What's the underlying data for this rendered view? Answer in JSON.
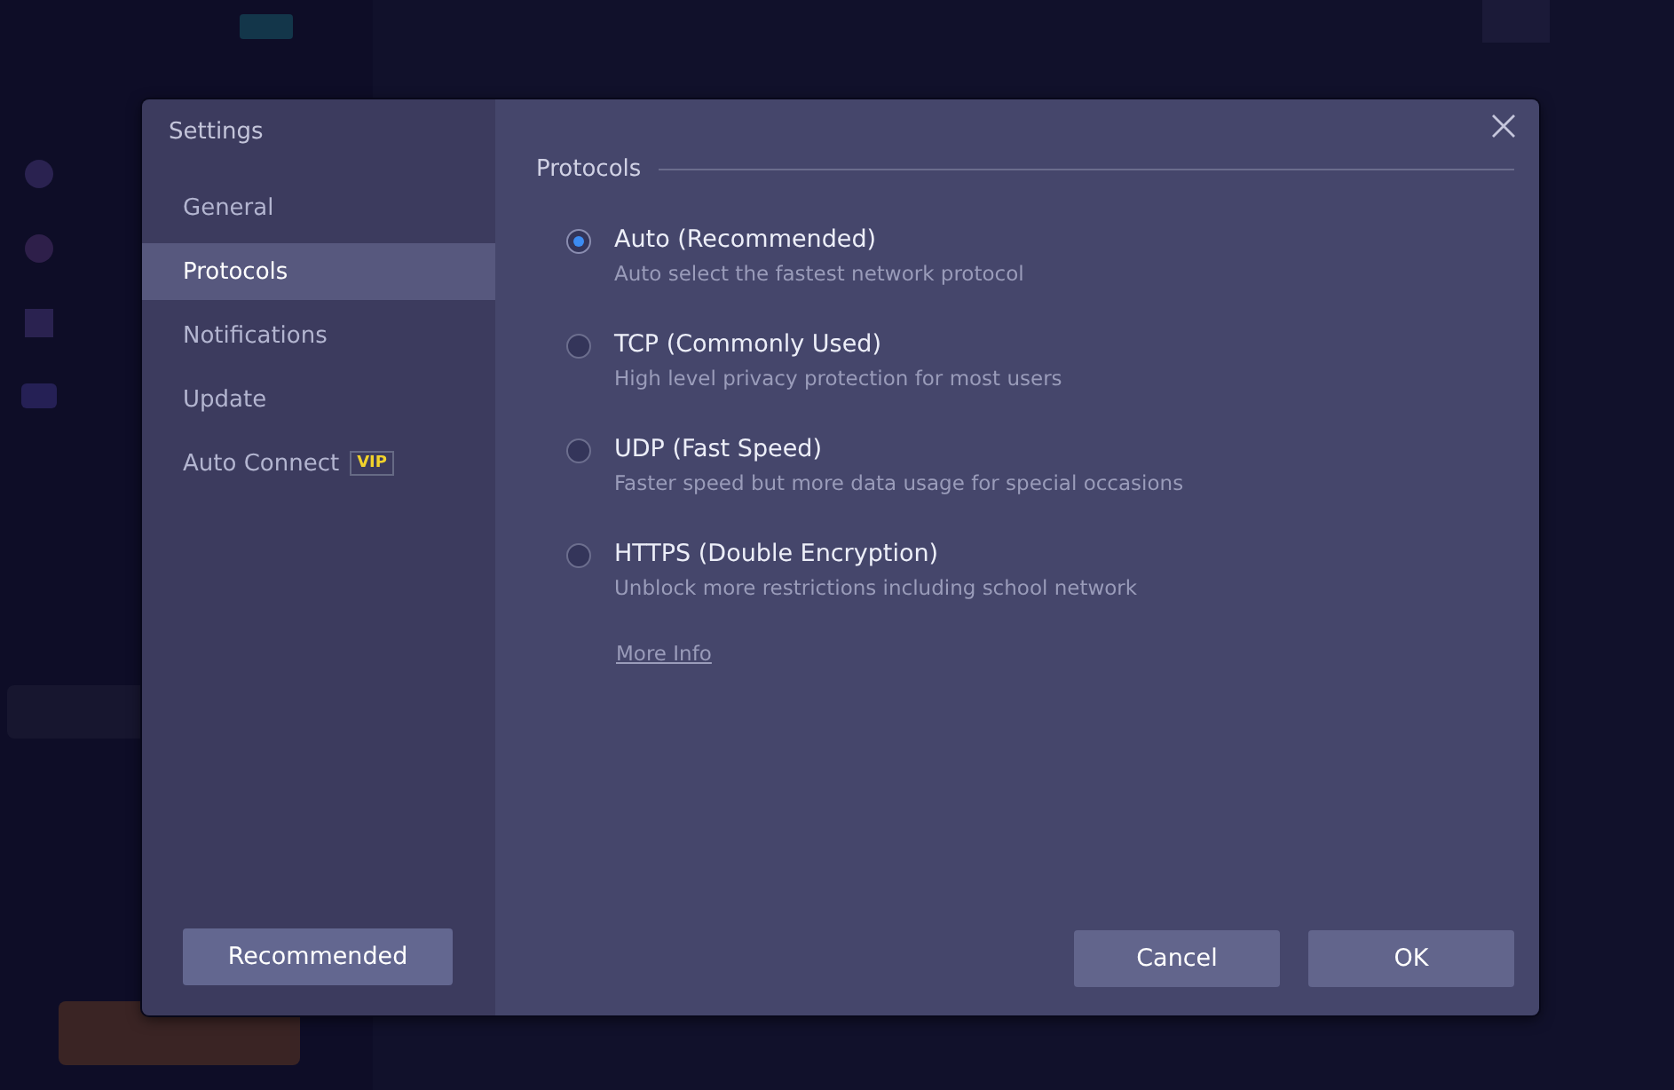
{
  "dialog": {
    "title": "Settings"
  },
  "sidebar": {
    "items": [
      {
        "label": "General",
        "selected": false
      },
      {
        "label": "Protocols",
        "selected": true
      },
      {
        "label": "Notifications",
        "selected": false
      },
      {
        "label": "Update",
        "selected": false
      },
      {
        "label": "Auto Connect",
        "badge": "VIP",
        "selected": false
      }
    ],
    "button": "Recommended"
  },
  "section": {
    "title": "Protocols",
    "options": [
      {
        "label": "Auto (Recommended)",
        "description": "Auto select the fastest network protocol",
        "selected": true
      },
      {
        "label": "TCP (Commonly Used)",
        "description": "High level privacy protection for most users",
        "selected": false
      },
      {
        "label": "UDP (Fast Speed)",
        "description": "Faster speed but more data usage for special occasions",
        "selected": false
      },
      {
        "label": "HTTPS (Double Encryption)",
        "description": "Unblock more restrictions including school network",
        "selected": false
      }
    ],
    "link": "More Info"
  },
  "buttons": [
    "Cancel",
    "OK"
  ]
}
